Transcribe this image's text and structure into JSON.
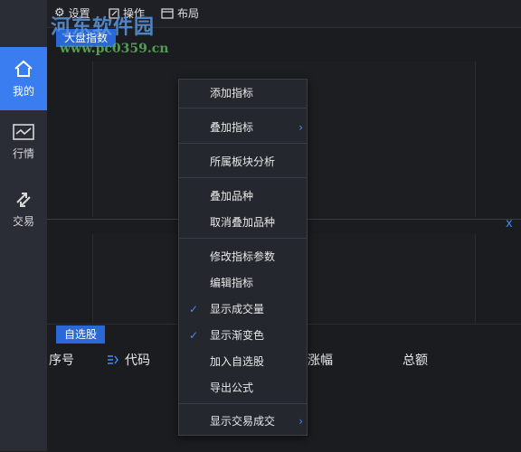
{
  "sidebar": {
    "items": [
      {
        "label": "我的",
        "icon": "home-icon",
        "active": true
      },
      {
        "label": "行情",
        "icon": "market-chart-icon",
        "active": false
      },
      {
        "label": "交易",
        "icon": "trade-arrows-icon",
        "active": false
      }
    ]
  },
  "toolbar": {
    "settings_label": "设置",
    "actions_label": "操作",
    "layout_label": "布局"
  },
  "watermark": {
    "title": "河东软件园",
    "url": "www.pc0359.cn"
  },
  "chart": {
    "tab_label": "大盘指数"
  },
  "watchlist": {
    "tab_label": "自选股",
    "columns": [
      "序号",
      "代码",
      "涨幅",
      "总额"
    ]
  },
  "context_menu": {
    "items": [
      {
        "label": "添加指标",
        "checked": false,
        "submenu": false
      },
      {
        "label": "叠加指标",
        "checked": false,
        "submenu": true
      },
      {
        "label": "所属板块分析",
        "checked": false,
        "submenu": false
      },
      {
        "label": "叠加品种",
        "checked": false,
        "submenu": false
      },
      {
        "label": "取消叠加品种",
        "checked": false,
        "submenu": false
      },
      {
        "label": "修改指标参数",
        "checked": false,
        "submenu": false
      },
      {
        "label": "编辑指标",
        "checked": false,
        "submenu": false
      },
      {
        "label": "显示成交量",
        "checked": true,
        "submenu": false
      },
      {
        "label": "显示渐变色",
        "checked": true,
        "submenu": false
      },
      {
        "label": "加入自选股",
        "checked": false,
        "submenu": false
      },
      {
        "label": "导出公式",
        "checked": false,
        "submenu": false
      },
      {
        "label": "显示交易成交",
        "checked": false,
        "submenu": true
      }
    ]
  },
  "close_glyph": "x",
  "colors": {
    "accent": "#3a7df0",
    "tab_blue": "#2a67d8",
    "background": "#1b1c20"
  }
}
